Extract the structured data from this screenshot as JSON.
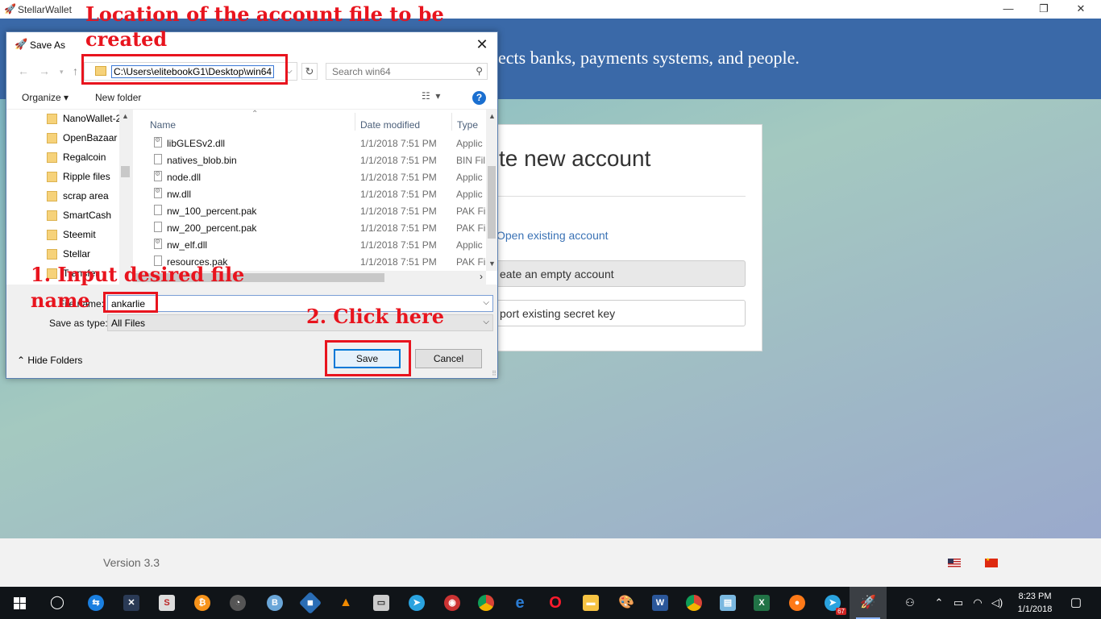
{
  "app": {
    "title": "StellarWallet",
    "tagline": "ects banks, payments systems, and people.",
    "card": {
      "title": "te new account",
      "open_link": "Open existing account",
      "empty_btn": "eate an empty account",
      "import_btn": "port existing secret key"
    },
    "version": "Version 3.3"
  },
  "window_controls": {
    "minimize": "—",
    "restore": "❐",
    "close": "✕"
  },
  "dialog": {
    "title": "Save As",
    "address": "C:\\Users\\elitebookG1\\Desktop\\win64",
    "search_placeholder": "Search win64",
    "toolbar": {
      "organize": "Organize ▾",
      "new_folder": "New folder",
      "help": "?"
    },
    "nav_items": [
      {
        "label": "NanoWallet-2"
      },
      {
        "label": "OpenBazaar"
      },
      {
        "label": "Regalcoin"
      },
      {
        "label": "Ripple files"
      },
      {
        "label": "scrap area"
      },
      {
        "label": "SmartCash"
      },
      {
        "label": "Steemit"
      },
      {
        "label": "Stellar"
      },
      {
        "label": "Transfer"
      }
    ],
    "columns": {
      "name": "Name",
      "date": "Date modified",
      "type": "Type"
    },
    "files": [
      {
        "name": "libGLESv2.dll",
        "date": "1/1/2018 7:51 PM",
        "type": "Applic",
        "icon": "dll"
      },
      {
        "name": "natives_blob.bin",
        "date": "1/1/2018 7:51 PM",
        "type": "BIN Fil",
        "icon": "file"
      },
      {
        "name": "node.dll",
        "date": "1/1/2018 7:51 PM",
        "type": "Applic",
        "icon": "dll"
      },
      {
        "name": "nw.dll",
        "date": "1/1/2018 7:51 PM",
        "type": "Applic",
        "icon": "dll"
      },
      {
        "name": "nw_100_percent.pak",
        "date": "1/1/2018 7:51 PM",
        "type": "PAK Fi",
        "icon": "file"
      },
      {
        "name": "nw_200_percent.pak",
        "date": "1/1/2018 7:51 PM",
        "type": "PAK Fi",
        "icon": "file"
      },
      {
        "name": "nw_elf.dll",
        "date": "1/1/2018 7:51 PM",
        "type": "Applic",
        "icon": "dll"
      },
      {
        "name": "resources.pak",
        "date": "1/1/2018 7:51 PM",
        "type": "PAK Fi",
        "icon": "file"
      }
    ],
    "filename_label": "File name:",
    "filename_value": "ankarlie",
    "savetype_label": "Save as type:",
    "savetype_value": "All Files",
    "hide_folders": "Hide Folders",
    "save_btn": "Save",
    "cancel_btn": "Cancel"
  },
  "annotations": {
    "location_line1": "Location of the account file to be",
    "location_line2": "created",
    "step1_line1": "1. Input desired file",
    "step1_line2": "name",
    "step2": "2. Click here",
    "color": "#e8141e"
  },
  "taskbar": {
    "clock_time": "8:23 PM",
    "clock_date": "1/1/2018",
    "telegram_badge": "67",
    "icons": [
      "search-circle-icon",
      "teamviewer-icon",
      "exodus-icon",
      "sketch-s-icon",
      "bitcoin-icon",
      "speedometer-icon",
      "bitcoin-wallet-icon",
      "waves-icon",
      "vlc-icon",
      "monitor-icon",
      "telegram-icon",
      "cast-icon",
      "chrome-icon",
      "edge-icon",
      "opera-icon",
      "file-explorer-icon",
      "paint-icon",
      "word-icon",
      "chrome-user-icon",
      "notepad-icon",
      "excel-icon",
      "firefox-icon",
      "telegram-icon",
      "stellar-rocket-icon"
    ]
  }
}
